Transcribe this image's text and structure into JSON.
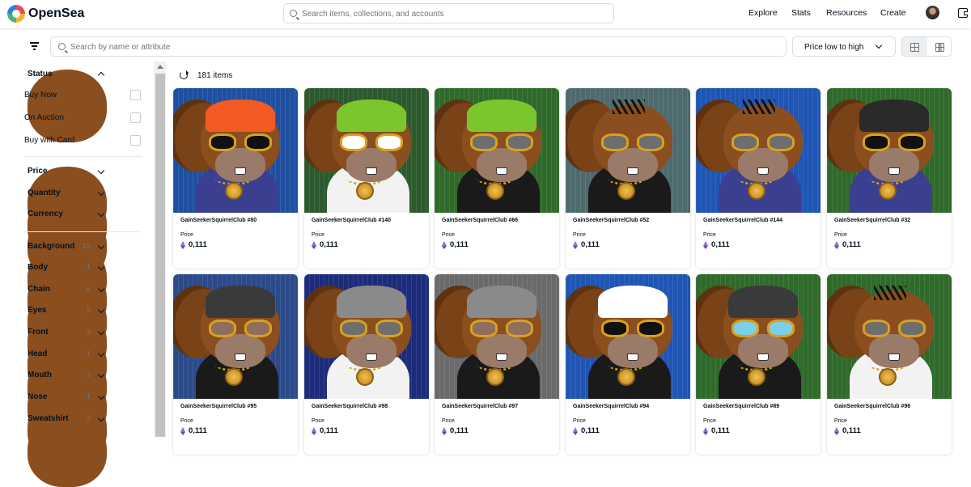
{
  "header": {
    "brand": "OpenSea",
    "search_placeholder": "Search items, collections, and accounts",
    "nav": [
      "Explore",
      "Stats",
      "Resources",
      "Create"
    ]
  },
  "toolbar": {
    "attr_search_placeholder": "Search by name or attribute",
    "sort_label": "Price low to high"
  },
  "sidebar": {
    "status_title": "Status",
    "status_options": [
      "Buy Now",
      "On Auction",
      "Buy with Card"
    ],
    "filters": [
      "Price",
      "Quantity",
      "Currency"
    ],
    "traits": [
      {
        "label": "Background",
        "count": "15"
      },
      {
        "label": "Body",
        "count": "1"
      },
      {
        "label": "Chain",
        "count": "6"
      },
      {
        "label": "Eyes",
        "count": "5"
      },
      {
        "label": "Front",
        "count": "3"
      },
      {
        "label": "Head",
        "count": "1"
      },
      {
        "label": "Mouth",
        "count": "3"
      },
      {
        "label": "Nose",
        "count": "1"
      },
      {
        "label": "Sweatshirt",
        "count": "3"
      }
    ]
  },
  "results": {
    "count_text": "181 items",
    "price_label": "Price",
    "items": [
      {
        "name": "GainSeekerSquirrelClub #80",
        "price": "0,111",
        "bg": "#1f4fa0",
        "hat": "#f15a22",
        "shirt": "#3b3f8f",
        "eyes": "dark"
      },
      {
        "name": "GainSeekerSquirrelClub #140",
        "price": "0,111",
        "bg": "#2c5a2e",
        "hat": "#7cc62d",
        "shirt": "#f2f2f2",
        "eyes": "cartoon"
      },
      {
        "name": "GainSeekerSquirrelClub #66",
        "price": "0,111",
        "bg": "#2f6a2a",
        "hat": "#7cc62d",
        "shirt": "#1a1a1a",
        "eyes": "gold"
      },
      {
        "name": "GainSeekerSquirrelClub #52",
        "price": "0,111",
        "bg": "#4d6b6e",
        "hat": "none",
        "shirt": "#1a1a1a",
        "eyes": "gold"
      },
      {
        "name": "GainSeekerSquirrelClub #144",
        "price": "0,111",
        "bg": "#1f55b4",
        "hat": "none",
        "shirt": "#3b3f8f",
        "eyes": "gold"
      },
      {
        "name": "GainSeekerSquirrelClub #32",
        "price": "0,111",
        "bg": "#2f6a2a",
        "hat": "#2a2a2a",
        "shirt": "#3b3f8f",
        "eyes": "dark"
      },
      {
        "name": "GainSeekerSquirrelClub #95",
        "price": "0,111",
        "bg": "#2a4a8a",
        "hat": "#3a3a3a",
        "shirt": "#1a1a1a",
        "eyes": "squint"
      },
      {
        "name": "GainSeekerSquirrelClub #98",
        "price": "0,111",
        "bg": "#1c2c7a",
        "hat": "#8a8a8a",
        "shirt": "#f2f2f2",
        "eyes": "gold"
      },
      {
        "name": "GainSeekerSquirrelClub #97",
        "price": "0,111",
        "bg": "#6a6a6a",
        "hat": "#8a8a8a",
        "shirt": "#1a1a1a",
        "eyes": "squint"
      },
      {
        "name": "GainSeekerSquirrelClub #94",
        "price": "0,111",
        "bg": "#1f55b4",
        "hat": "#ffffff",
        "shirt": "#1a1a1a",
        "eyes": "dark"
      },
      {
        "name": "GainSeekerSquirrelClub #89",
        "price": "0,111",
        "bg": "#2f6a2a",
        "hat": "#3a3a3a",
        "shirt": "#1a1a1a",
        "eyes": "blue"
      },
      {
        "name": "GainSeekerSquirrelClub #96",
        "price": "0,111",
        "bg": "#2f6a2a",
        "hat": "none",
        "shirt": "#f2f2f2",
        "eyes": "gold"
      }
    ]
  }
}
